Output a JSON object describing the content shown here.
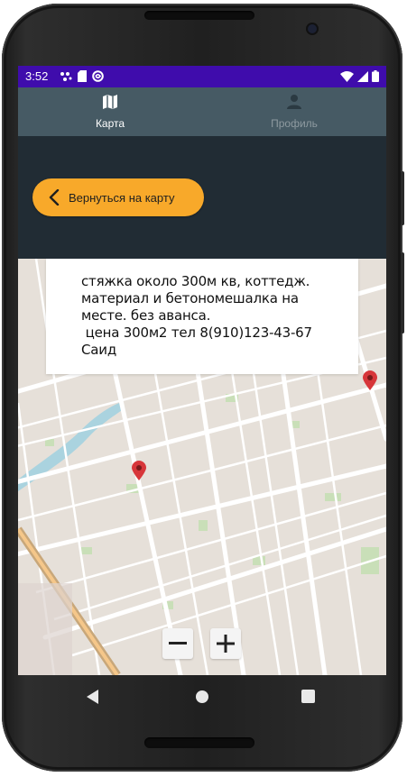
{
  "statusbar": {
    "time": "3:52",
    "left_icons": [
      "notification-dots-icon",
      "sd-card-icon",
      "no-disturb-icon"
    ],
    "right_icons": [
      "wifi-icon",
      "signal-icon",
      "battery-icon"
    ]
  },
  "tabs": [
    {
      "label": "Карта",
      "icon": "map-icon",
      "active": true
    },
    {
      "label": "Профиль",
      "icon": "person-icon",
      "active": false
    }
  ],
  "back_button": {
    "label": "Вернуться на карту",
    "icon": "chevron-left-icon"
  },
  "info_card": {
    "text": "стяжка около 300м кв, коттедж.\nматериал и бетономешалка на\nместе. без аванса.\n цена 300м2 тел 8(910)123-43-67\nСаид"
  },
  "zoom": {
    "minus": "−",
    "plus": "+"
  },
  "navbar": [
    "back-triangle-icon",
    "home-circle-icon",
    "recents-square-icon"
  ],
  "colors": {
    "statusbar": "#3f0cac",
    "tabbar": "#465a64",
    "panel": "#212c34",
    "accent": "#f8a92a",
    "marker": "#d7363a"
  }
}
